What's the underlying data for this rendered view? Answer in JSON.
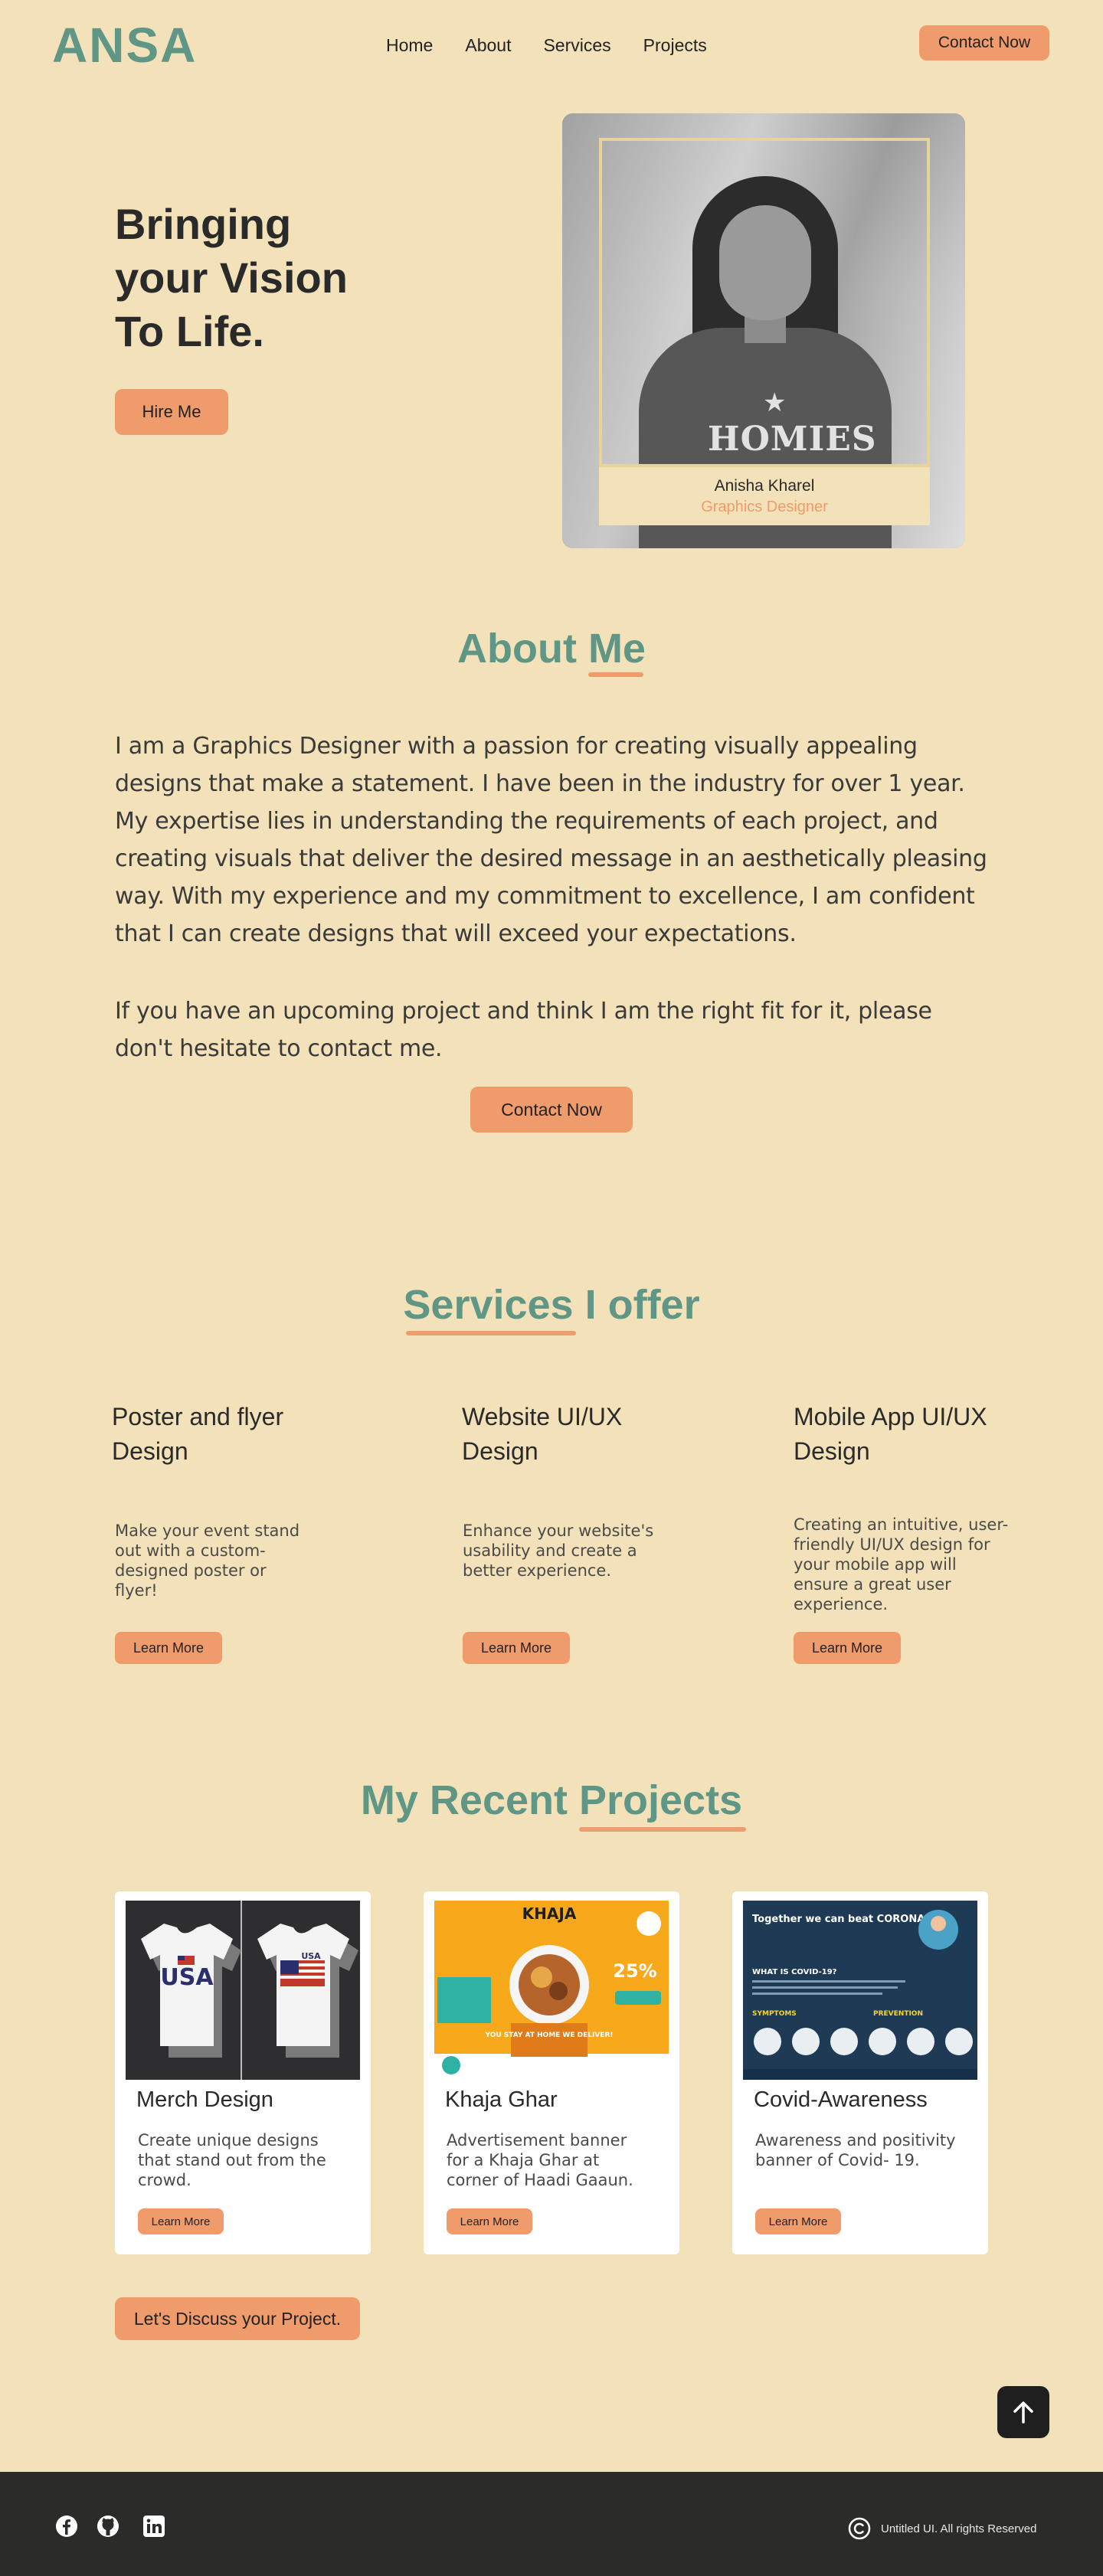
{
  "header": {
    "logo": "ANSA",
    "nav": [
      "Home",
      "About",
      "Services",
      "Projects"
    ],
    "contact_label": "Contact Now"
  },
  "hero": {
    "title_lines": [
      "Bringing",
      "your Vision",
      "To Life."
    ],
    "hire_label": "Hire Me",
    "shirt_text": "HOMIES",
    "name": "Anisha Kharel",
    "role": "Graphics Designer"
  },
  "about": {
    "title": "About Me",
    "paragraph1": "I am a Graphics Designer with a passion for creating visually appealing designs that make a statement. I have been in the industry for over 1 year. My expertise lies in understanding the requirements of each project, and creating visuals that deliver the desired message in an aesthetically pleasing way. With my experience and my commitment to excellence, I am confident that I can create designs that will exceed your expectations.",
    "paragraph2": "If you have an upcoming project and think I am the right fit for it, please don't hesitate to contact me.",
    "contact_label": "Contact Now"
  },
  "services": {
    "title": "Services I offer",
    "items": [
      {
        "title": "Poster and flyer Design",
        "desc": "Make your event stand out with a custom-designed poster or flyer!",
        "button": "Learn More"
      },
      {
        "title": "Website UI/UX Design",
        "desc": "Enhance your website's usability and create a better experience.",
        "button": "Learn More"
      },
      {
        "title": "Mobile App UI/UX Design",
        "desc": "Creating an intuitive, user-friendly UI/UX design for your mobile app will ensure a great user experience.",
        "button": "Learn More"
      }
    ]
  },
  "projects": {
    "title": "My Recent Projects",
    "items": [
      {
        "title": "Merch Design",
        "desc": "Create unique designs that stand out from the crowd.",
        "button": "Learn More",
        "img_text": "USA"
      },
      {
        "title": "Khaja Ghar",
        "desc": "Advertisement banner for a Khaja Ghar at corner of Haadi Gaaun.",
        "button": "Learn More",
        "img_text": "KHAJA",
        "img_sub": "YOU STAY AT HOME WE DELIVER!",
        "img_badge": "25%"
      },
      {
        "title": "Covid-Awareness",
        "desc": "Awareness and positivity banner of  Covid- 19.",
        "button": "Learn More",
        "img_text": "Together we can beat CORONA",
        "img_sub": "WHAT IS COVID-19?",
        "img_symptoms": "SYMPTOMS",
        "img_prevention": "PREVENTION"
      }
    ],
    "discuss_label": "Let's Discuss your Project."
  },
  "footer": {
    "copyright": "Untitled UI. All rights Reserved",
    "icons": [
      "facebook-icon",
      "github-icon",
      "linkedin-icon"
    ]
  },
  "colors": {
    "background": "#f3e2b9",
    "accent_green": "#5f9685",
    "accent_orange": "#f09b6b",
    "footer": "#2b2b29"
  }
}
